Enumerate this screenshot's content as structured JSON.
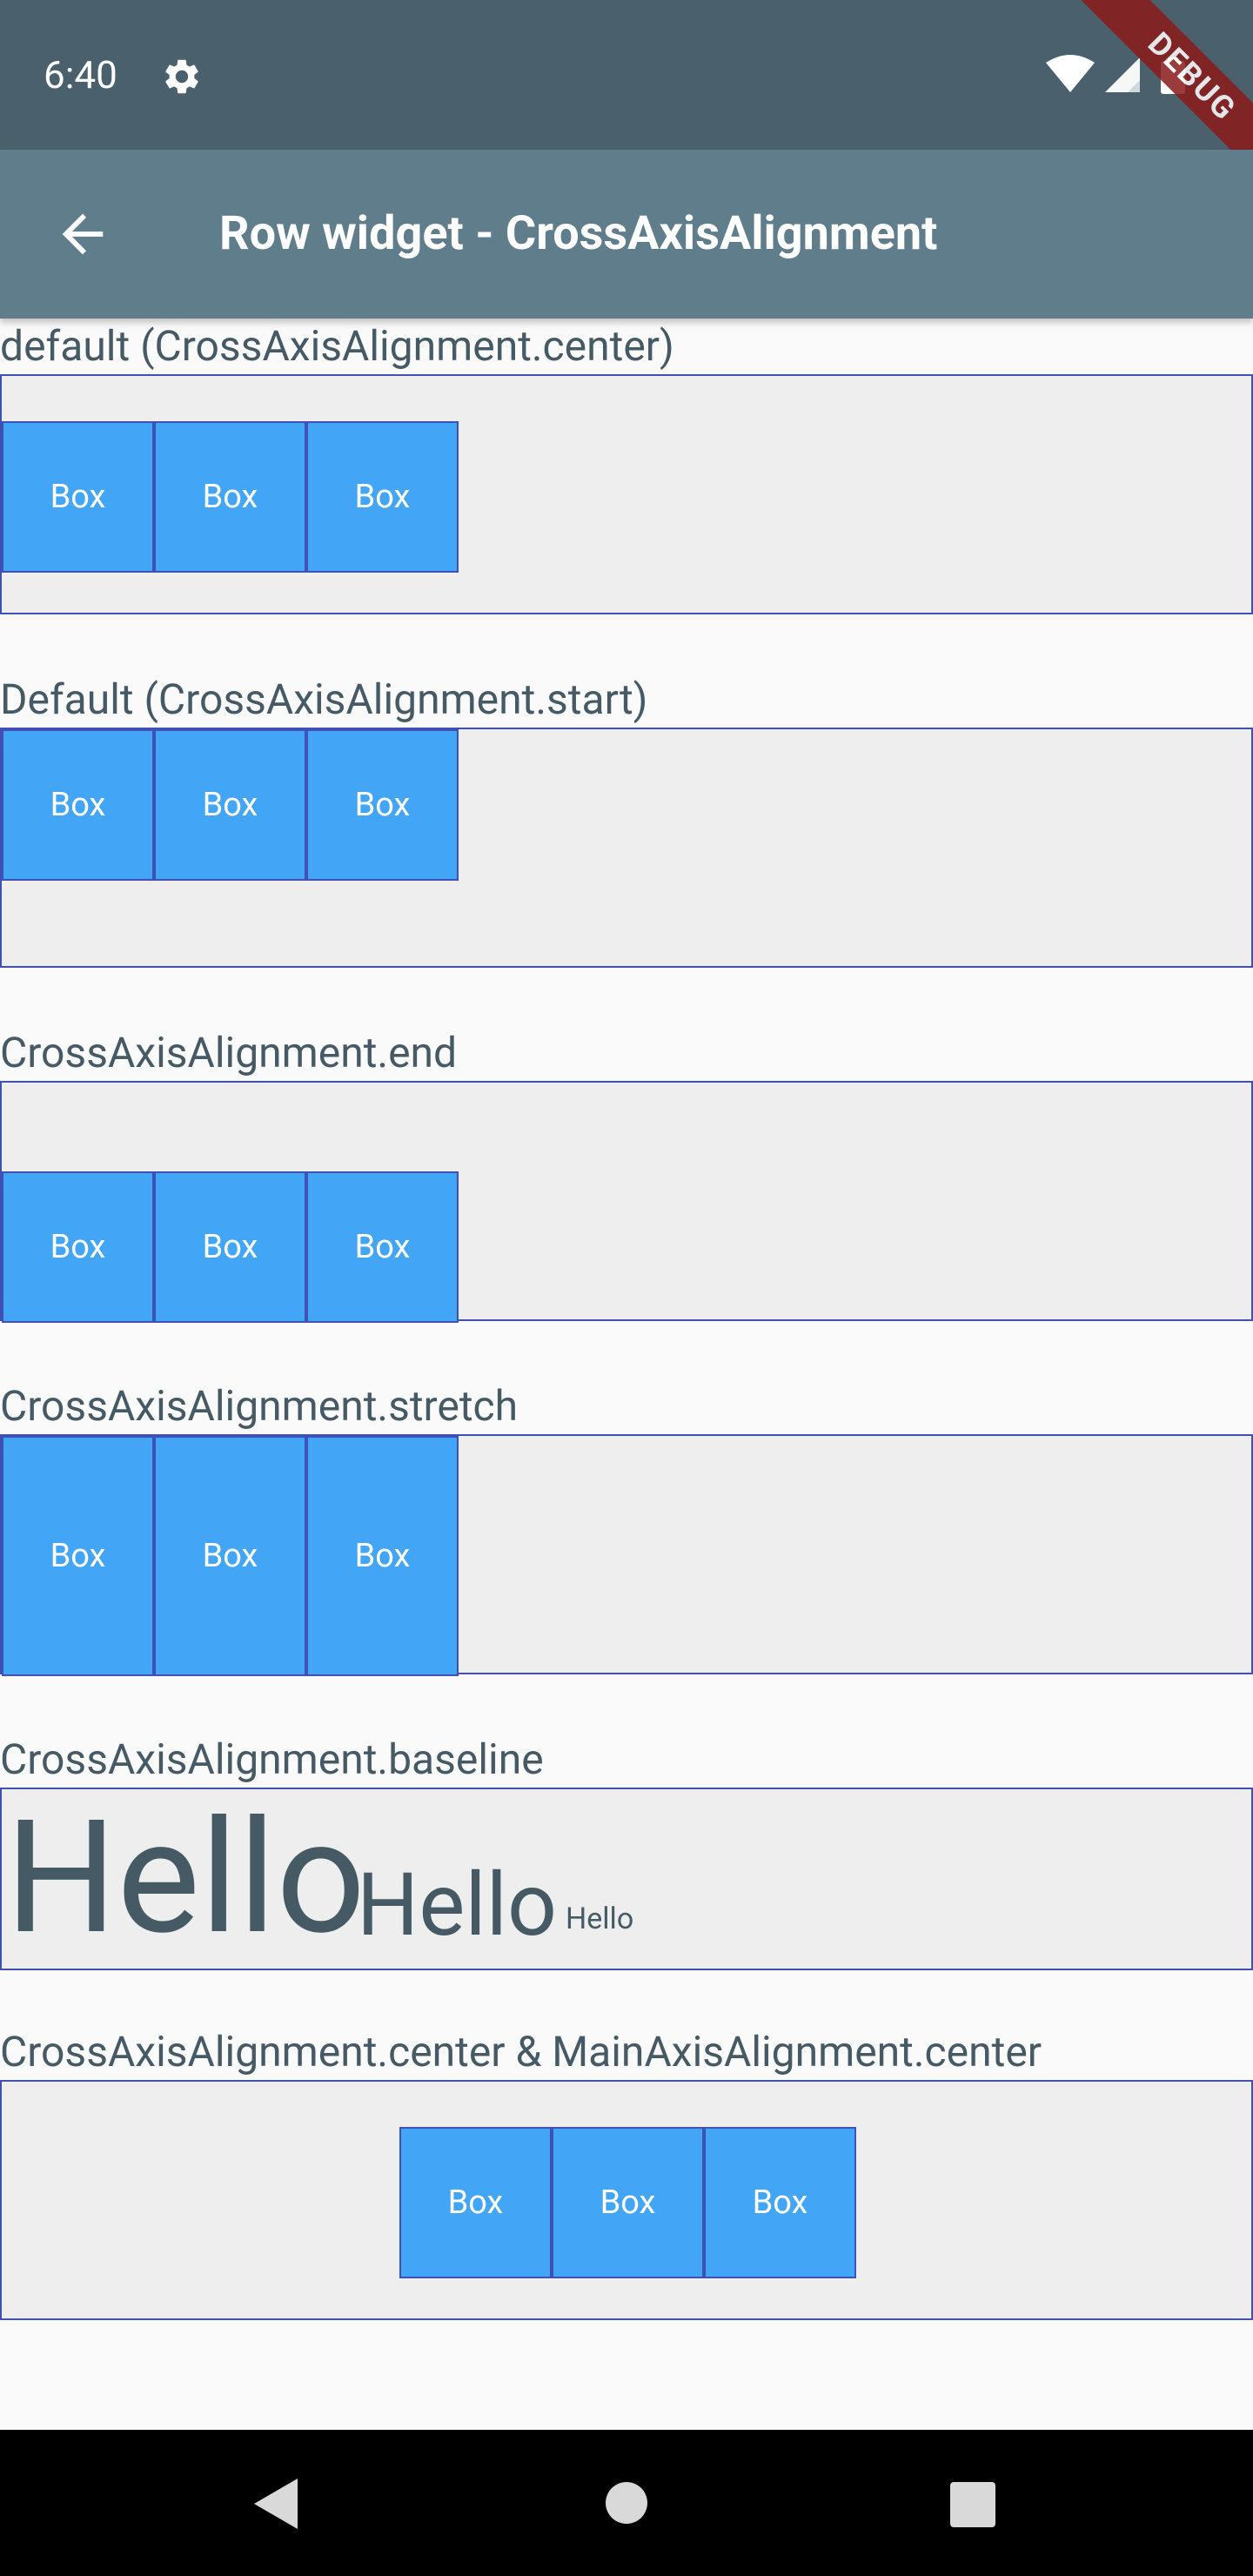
{
  "status_bar": {
    "time": "6:40",
    "settings_icon": "gear-icon",
    "wifi_icon": "wifi-icon",
    "signal_icon": "cell-signal-icon",
    "battery_icon": "battery-icon",
    "debug_banner": "DEBUG"
  },
  "app_bar": {
    "back_icon": "arrow-back-icon",
    "title": "Row widget - CrossAxisAlignment"
  },
  "sections": {
    "center": {
      "label": "default (CrossAxisAlignment.center)",
      "boxes": [
        "Box",
        "Box",
        "Box"
      ]
    },
    "start": {
      "label": "Default (CrossAxisAlignment.start)",
      "boxes": [
        "Box",
        "Box",
        "Box"
      ]
    },
    "end": {
      "label": "CrossAxisAlignment.end",
      "boxes": [
        "Box",
        "Box",
        "Box"
      ]
    },
    "stretch": {
      "label": "CrossAxisAlignment.stretch",
      "boxes": [
        "Box",
        "Box",
        "Box"
      ]
    },
    "baseline": {
      "label": "CrossAxisAlignment.baseline",
      "words": [
        "Hello",
        "Hello",
        "Hello"
      ]
    },
    "center_center": {
      "label": "CrossAxisAlignment.center & MainAxisAlignment.center",
      "boxes": [
        "Box",
        "Box",
        "Box"
      ]
    }
  },
  "nav_bar": {
    "back_icon": "nav-back-icon",
    "home_icon": "nav-home-icon",
    "recents_icon": "nav-recents-icon"
  },
  "colors": {
    "status_bar": "#4a616d",
    "app_bar": "#607d8b",
    "box_fill": "#42a5f5",
    "panel_border": "#3f51b5",
    "panel_fill": "#eeeeee",
    "text": "#455a64"
  }
}
